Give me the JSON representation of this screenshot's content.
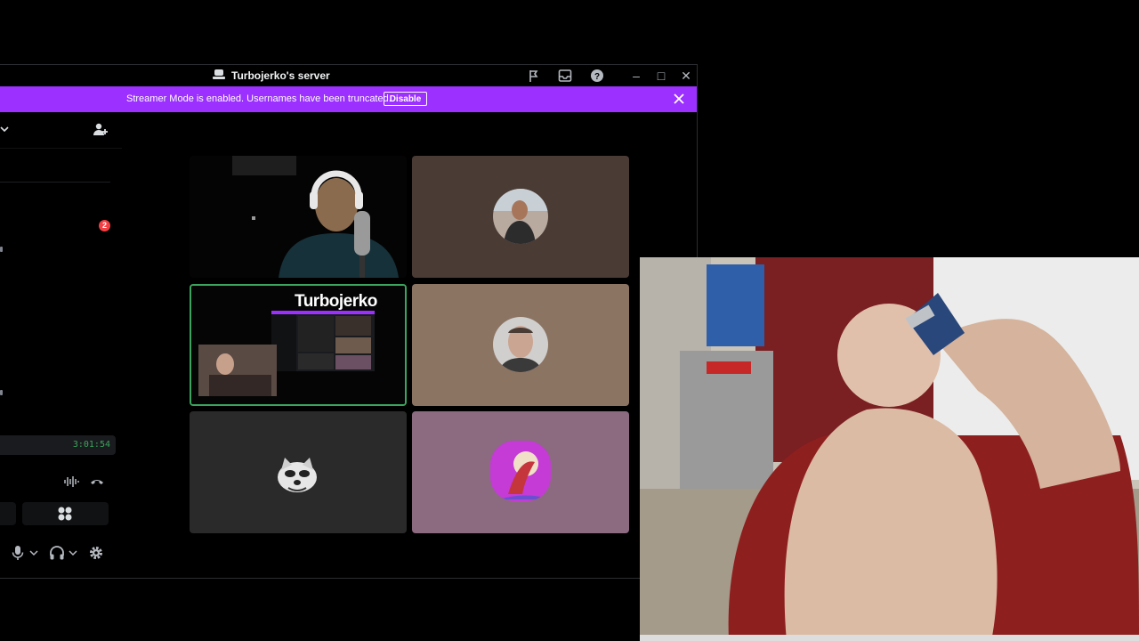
{
  "window": {
    "title": "Turbojerko's server"
  },
  "banner": {
    "message": "Streamer Mode is enabled. Usernames have been truncated.",
    "disable_label": "Disable"
  },
  "sidebar": {
    "notification_count": "2",
    "voice_timer": "3:01:54"
  },
  "stage": {
    "stream_title": "Turbojerko"
  },
  "colors": {
    "banner": "#9b30ff",
    "speaking_outline": "#3ba55d",
    "badge": "#f23f43",
    "tile_brown": "#4a3b34",
    "tile_tan": "#8c7463",
    "tile_gray": "#2a2a2a",
    "tile_mauve": "#8c6a80"
  },
  "icons": [
    "server-icon",
    "report-flag-icon",
    "inbox-icon",
    "help-icon",
    "minimize-icon",
    "maximize-icon",
    "close-icon",
    "banner-close-icon",
    "chevron-down-icon",
    "add-user-icon",
    "soundboard-icon",
    "disconnect-icon",
    "activity-icon",
    "microphone-icon",
    "headphones-icon",
    "settings-gear-icon"
  ]
}
